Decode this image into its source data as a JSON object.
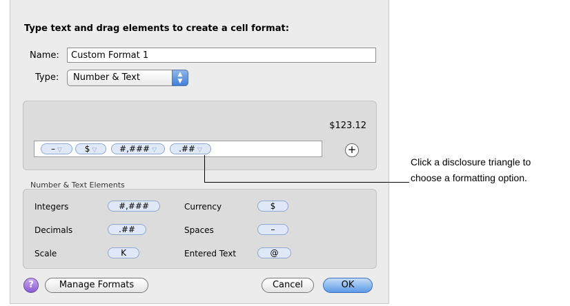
{
  "dialog": {
    "title": "Type text and drag elements to create a cell format:",
    "name_label": "Name:",
    "name_value": "Custom Format 1",
    "type_label": "Type:",
    "type_value": "Number & Text",
    "preview": "$123.12",
    "tokens": [
      "–",
      "$",
      "#,###",
      ".##"
    ],
    "elements_label": "Number & Text Elements",
    "elements": {
      "integers_label": "Integers",
      "integers_chip": "#,###",
      "currency_label": "Currency",
      "currency_chip": "$",
      "decimals_label": "Decimals",
      "decimals_chip": ".##",
      "spaces_label": "Spaces",
      "spaces_chip": "–",
      "scale_label": "Scale",
      "scale_chip": "K",
      "entered_text_label": "Entered Text",
      "entered_text_chip": "@"
    },
    "help_label": "?",
    "manage_label": "Manage Formats",
    "cancel_label": "Cancel",
    "ok_label": "OK"
  },
  "callout": {
    "line1": "Click a disclosure triangle to",
    "line2": "choose a formatting option."
  },
  "colors": {
    "token_fill": "#dfe8f7",
    "token_border": "#8ea7d3",
    "default_button": "#5d9ae6"
  }
}
